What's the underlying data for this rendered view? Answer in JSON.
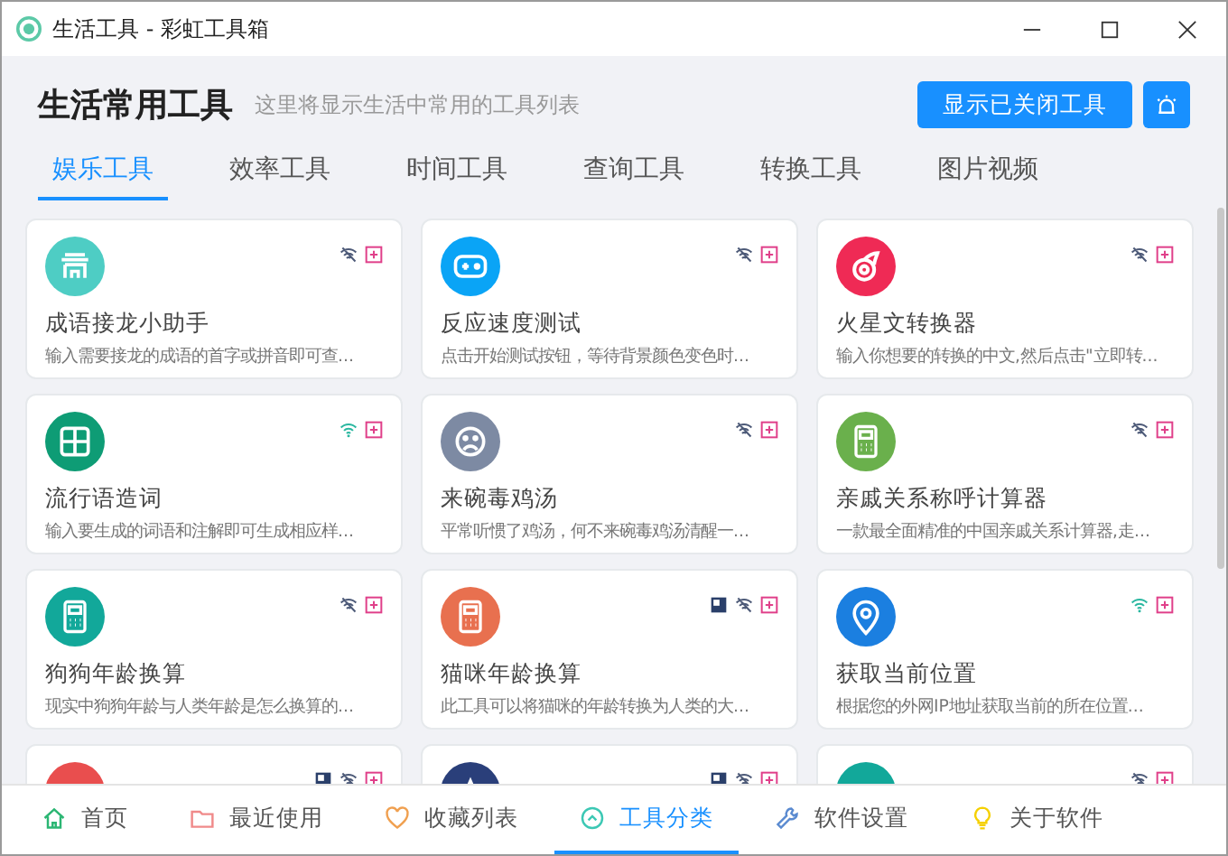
{
  "window": {
    "title": "生活工具 - 彩虹工具箱"
  },
  "header": {
    "title": "生活常用工具",
    "subtitle": "这里将显示生活中常用的工具列表",
    "button": "显示已关闭工具"
  },
  "tabs": [
    {
      "label": "娱乐工具",
      "selected": true
    },
    {
      "label": "效率工具",
      "selected": false
    },
    {
      "label": "时间工具",
      "selected": false
    },
    {
      "label": "查询工具",
      "selected": false
    },
    {
      "label": "转换工具",
      "selected": false
    },
    {
      "label": "图片视频",
      "selected": false
    }
  ],
  "tools": [
    {
      "kind": "temple",
      "color": "#4ecdc4",
      "online": false,
      "local": false,
      "name": "成语接龙小助手",
      "desc": "输入需要接龙的成语的首字或拼音即可查..."
    },
    {
      "kind": "gamepad",
      "color": "#0aa4f6",
      "online": false,
      "local": false,
      "name": "反应速度测试",
      "desc": "点击开始测试按钮，等待背景颜色变色时..."
    },
    {
      "kind": "fire",
      "color": "#ef2a55",
      "online": false,
      "local": false,
      "name": "火星文转换器",
      "desc": "输入你想要的转换的中文,然后点击\"立即转..."
    },
    {
      "kind": "grid",
      "color": "#0e9c75",
      "online": true,
      "local": false,
      "name": "流行语造词",
      "desc": "输入要生成的词语和注解即可生成相应样..."
    },
    {
      "kind": "sad",
      "color": "#7d8aa3",
      "online": false,
      "local": false,
      "name": "来碗毒鸡汤",
      "desc": "平常听惯了鸡汤，何不来碗毒鸡汤清醒一..."
    },
    {
      "kind": "calculator",
      "color": "#6ab04c",
      "online": false,
      "local": false,
      "name": "亲戚关系称呼计算器",
      "desc": "一款最全面精准的中国亲戚关系计算器,走..."
    },
    {
      "kind": "calculator",
      "color": "#12a89a",
      "online": false,
      "local": false,
      "name": "狗狗年龄换算",
      "desc": "现实中狗狗年龄与人类年龄是怎么换算的..."
    },
    {
      "kind": "calculator",
      "color": "#e8704f",
      "online": false,
      "local": true,
      "name": "猫咪年龄换算",
      "desc": "此工具可以将猫咪的年龄转换为人类的大..."
    },
    {
      "kind": "location",
      "color": "#1b7fe0",
      "online": true,
      "local": false,
      "name": "获取当前位置",
      "desc": "根据您的外网IP地址获取当前的所在位置..."
    },
    {
      "kind": "plain",
      "color": "#e94e4e",
      "online": false,
      "local": true
    },
    {
      "kind": "star",
      "color": "#2a3f7a",
      "online": false,
      "local": true
    },
    {
      "kind": "plain",
      "color": "#12a89a",
      "online": false,
      "local": false
    }
  ],
  "nav": [
    {
      "kind": "home",
      "label": "首页",
      "selected": false
    },
    {
      "kind": "folder",
      "label": "最近使用",
      "selected": false
    },
    {
      "kind": "heart",
      "label": "收藏列表",
      "selected": false
    },
    {
      "kind": "up",
      "label": "工具分类",
      "selected": true
    },
    {
      "kind": "wrench",
      "label": "软件设置",
      "selected": false
    },
    {
      "kind": "bulb",
      "label": "关于软件",
      "selected": false
    }
  ]
}
